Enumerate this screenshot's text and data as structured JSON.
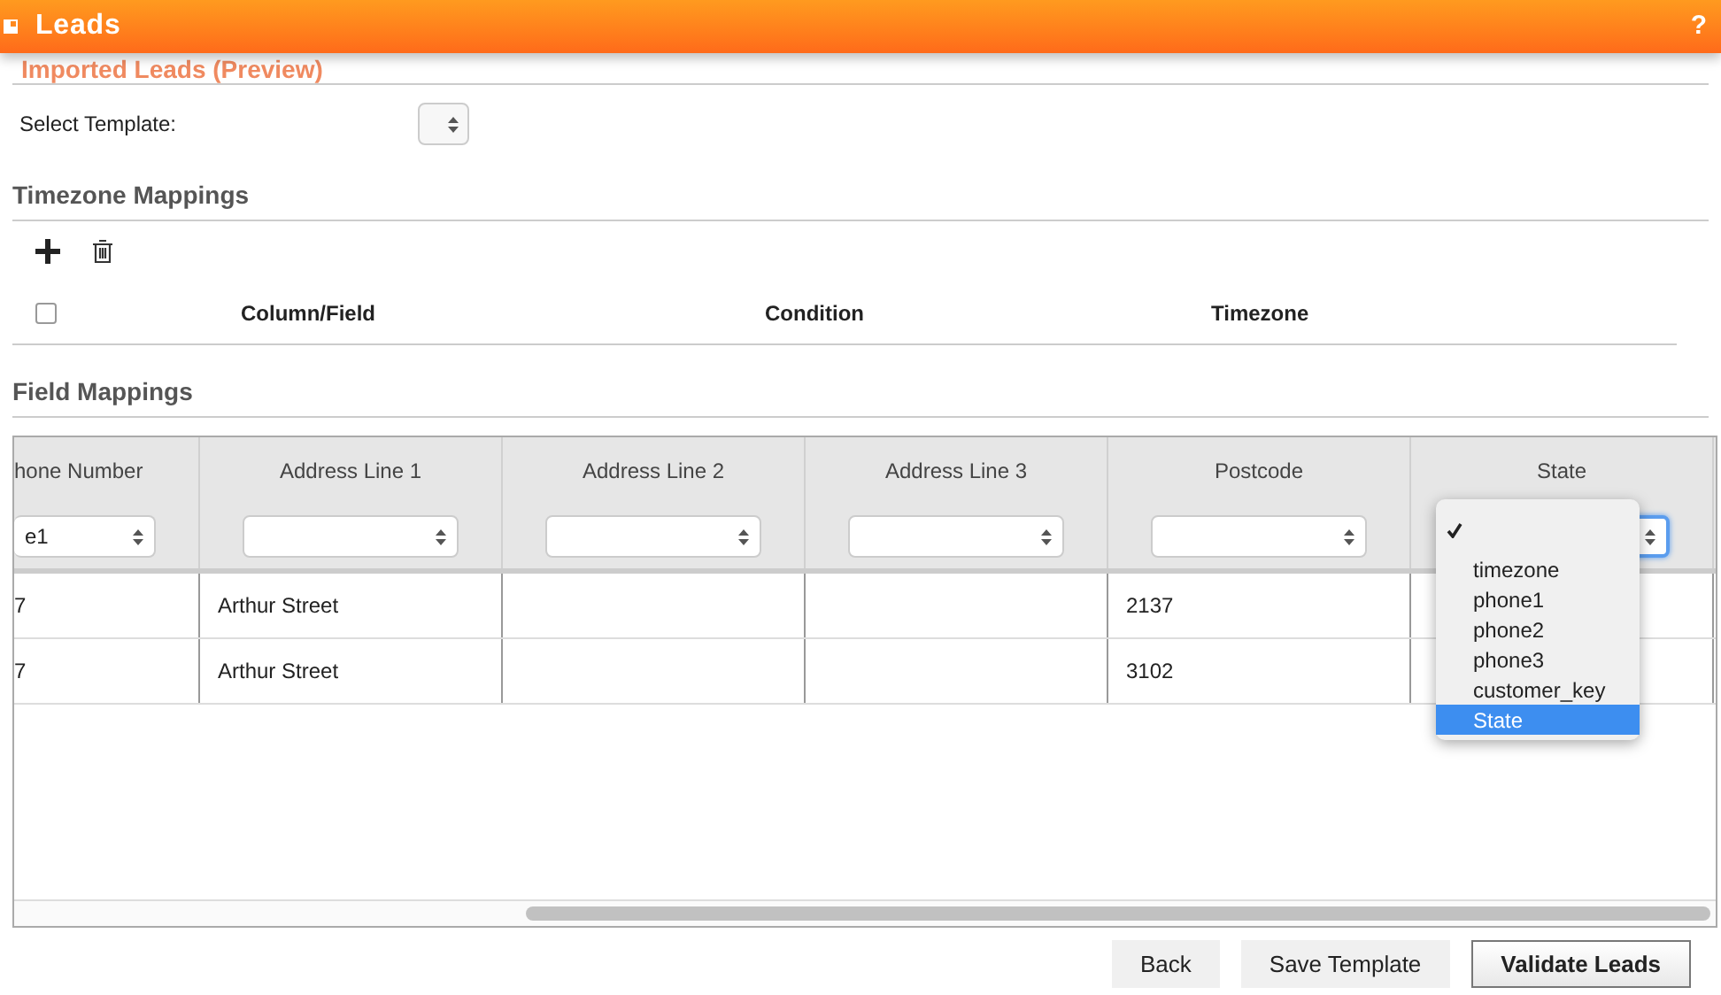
{
  "header": {
    "title": "Leads",
    "help": "?"
  },
  "preview_title": "Imported Leads (Preview)",
  "template": {
    "label": "Select Template:"
  },
  "timezone_mappings": {
    "title": "Timezone Mappings",
    "select_all_checked": false,
    "columns": [
      "Column/Field",
      "Condition",
      "Timezone"
    ]
  },
  "field_mappings": {
    "title": "Field Mappings",
    "columns": [
      {
        "label": "hone Number",
        "value": "e1",
        "focused": false
      },
      {
        "label": "Address Line 1",
        "focused": false
      },
      {
        "label": "Address Line 2",
        "focused": false
      },
      {
        "label": "Address Line 3",
        "focused": false
      },
      {
        "label": "Postcode",
        "focused": false
      },
      {
        "label": "State",
        "focused": true
      }
    ],
    "rows": [
      [
        "7",
        "Arthur Street",
        "",
        "",
        "2137",
        ""
      ],
      [
        "7",
        "Arthur Street",
        "",
        "",
        "3102",
        ""
      ]
    ],
    "dropdown": [
      {
        "checked": true,
        "selected": false
      },
      {
        "label": "timezone",
        "checked": false,
        "selected": false
      },
      {
        "label": "phone1",
        "checked": false,
        "selected": false
      },
      {
        "label": "phone2",
        "checked": false,
        "selected": false
      },
      {
        "label": "phone3",
        "checked": false,
        "selected": false
      },
      {
        "label": "customer_key",
        "checked": false,
        "selected": false
      },
      {
        "label": "State",
        "checked": false,
        "selected": true
      }
    ]
  },
  "buttons": [
    {
      "label": "Back",
      "kind": "secondary"
    },
    {
      "label": "Save Template",
      "kind": "secondary"
    },
    {
      "label": "Validate Leads",
      "kind": "primary"
    }
  ]
}
